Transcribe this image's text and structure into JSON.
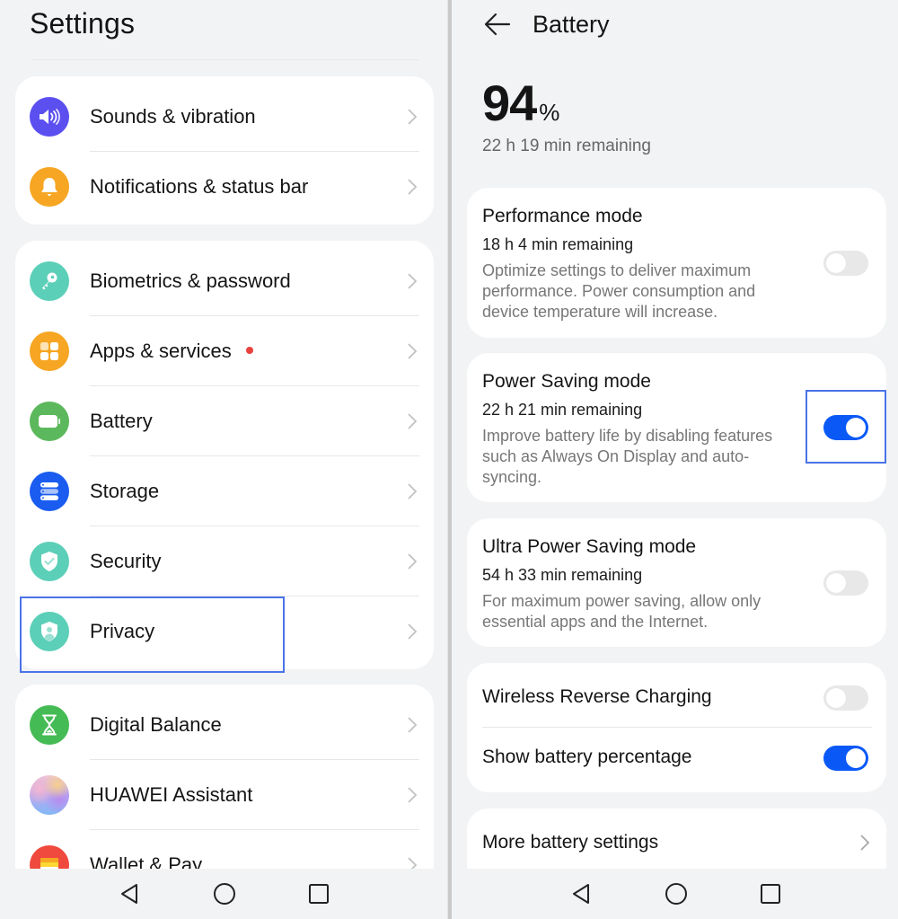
{
  "settings": {
    "title": "Settings",
    "groups": [
      {
        "items": [
          {
            "label": "Sounds & vibration",
            "icon": "speaker-icon",
            "color": "#5b4ff0"
          },
          {
            "label": "Notifications & status bar",
            "icon": "bell-icon",
            "color": "#f6a623"
          }
        ]
      },
      {
        "items": [
          {
            "label": "Biometrics & password",
            "icon": "key-icon",
            "color": "#5ccfb8"
          },
          {
            "label": "Apps & services",
            "icon": "apps-grid-icon",
            "color": "#f6a623",
            "badge": true
          },
          {
            "label": "Battery",
            "icon": "battery-icon",
            "color": "#5cb85c"
          },
          {
            "label": "Storage",
            "icon": "storage-icon",
            "color": "#1a5cf0"
          },
          {
            "label": "Security",
            "icon": "shield-check-icon",
            "color": "#5ccfb8"
          },
          {
            "label": "Privacy",
            "icon": "privacy-shield-icon",
            "color": "#5ccfb8",
            "highlighted": true
          }
        ]
      },
      {
        "items": [
          {
            "label": "Digital Balance",
            "icon": "hourglass-icon",
            "color": "#45bb55"
          },
          {
            "label": "HUAWEI Assistant",
            "icon": "assistant-orb-icon",
            "color": "#b9a3f0"
          },
          {
            "label": "Wallet & Pay",
            "icon": "wallet-icon",
            "color": "#f0493d"
          }
        ]
      }
    ]
  },
  "battery": {
    "title": "Battery",
    "percent": "94",
    "percent_sign": "%",
    "remaining": "22 h 19 min remaining",
    "modes": [
      {
        "title": "Performance mode",
        "remaining": "18 h 4 min remaining",
        "description": "Optimize settings to deliver maximum performance. Power consumption and device temperature will increase.",
        "enabled": false
      },
      {
        "title": "Power Saving mode",
        "remaining": "22 h 21 min remaining",
        "description": "Improve battery life by disabling features such as Always On Display and auto-syncing.",
        "enabled": true,
        "highlighted": true
      },
      {
        "title": "Ultra Power Saving mode",
        "remaining": "54 h 33 min remaining",
        "description": "For maximum power saving, allow only essential apps and the Internet.",
        "enabled": false
      }
    ],
    "toggles": [
      {
        "label": "Wireless Reverse Charging",
        "enabled": false
      },
      {
        "label": "Show battery percentage",
        "enabled": true
      }
    ],
    "more": "More battery settings"
  },
  "nav": {
    "back": "back-nav-icon",
    "home": "home-nav-icon",
    "recents": "recents-nav-icon"
  },
  "colors": {
    "accent": "#0a59f7",
    "highlight_box": "#4a73e8",
    "badge": "#e8413b"
  }
}
